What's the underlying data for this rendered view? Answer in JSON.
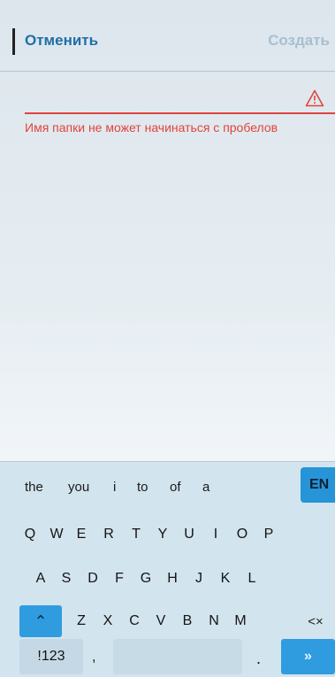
{
  "header": {
    "cancel_label": "Отменить",
    "create_label": "Создать"
  },
  "field": {
    "error_text": "Имя папки не может начинаться с пробелов",
    "warning_icon": "warning-triangle-icon",
    "error_color": "#e0443e"
  },
  "keyboard": {
    "suggestions": [
      "the",
      "you",
      "i",
      "to",
      "of",
      "a"
    ],
    "lang_label": "EN",
    "row1": [
      "Q",
      "W",
      "E",
      "R",
      "T",
      "Y",
      "U",
      "I",
      "O",
      "P"
    ],
    "row2": [
      "A",
      "S",
      "D",
      "F",
      "G",
      "H",
      "J",
      "K",
      "L"
    ],
    "row3": [
      "Z",
      "X",
      "C",
      "V",
      "B",
      "N",
      "M"
    ],
    "shift_glyph": "⌃",
    "backspace_glyph": "<×",
    "numbers_label": "!123",
    "comma_label": ",",
    "period_label": ".",
    "enter_glyph": "»",
    "accent_color": "#2f9ce0"
  }
}
